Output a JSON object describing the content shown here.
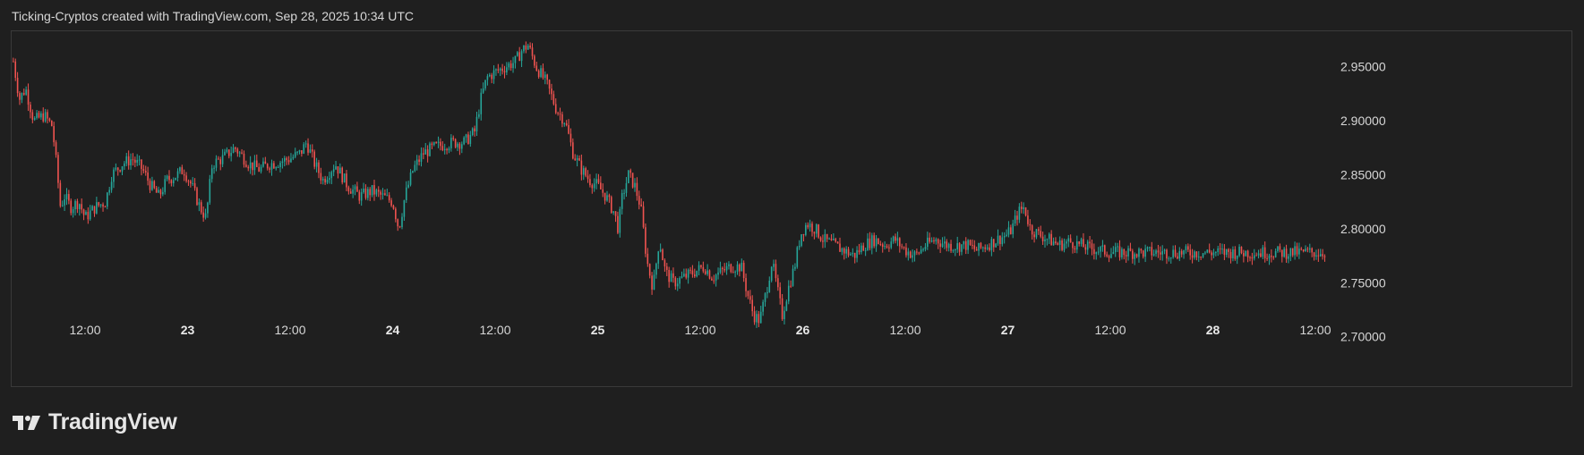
{
  "header": {
    "text": "Ticking-Cryptos created with TradingView.com, Sep 28, 2025 10:34 UTC"
  },
  "brand": {
    "name": "TradingView",
    "logo_icon": "tradingview-logo-icon"
  },
  "colors": {
    "background": "#1f1f1f",
    "up": "#26a69a",
    "down": "#ef5350",
    "text": "#d6d6d6",
    "border": "#3a3a3a"
  },
  "chart_data": {
    "type": "candlestick",
    "title": "",
    "xlabel": "",
    "ylabel": "",
    "ylim": [
      2.68,
      3.0
    ],
    "y_ticks": [
      "2.95000",
      "2.90000",
      "2.85000",
      "2.80000",
      "2.75000",
      "2.70000"
    ],
    "x_ticks": [
      {
        "label": "12:00",
        "t": 0.5,
        "bold": false
      },
      {
        "label": "23",
        "t": 1.0,
        "bold": true
      },
      {
        "label": "12:00",
        "t": 1.5,
        "bold": false
      },
      {
        "label": "24",
        "t": 2.0,
        "bold": true
      },
      {
        "label": "12:00",
        "t": 2.5,
        "bold": false
      },
      {
        "label": "25",
        "t": 3.0,
        "bold": true
      },
      {
        "label": "12:00",
        "t": 3.5,
        "bold": false
      },
      {
        "label": "26",
        "t": 4.0,
        "bold": true
      },
      {
        "label": "12:00",
        "t": 4.5,
        "bold": false
      },
      {
        "label": "27",
        "t": 5.0,
        "bold": true
      },
      {
        "label": "12:00",
        "t": 5.5,
        "bold": false
      },
      {
        "label": "28",
        "t": 6.0,
        "bold": true
      },
      {
        "label": "12:00",
        "t": 6.5,
        "bold": false
      }
    ],
    "x_range": [
      0.15,
      6.55
    ],
    "grid": false,
    "price_path": [
      [
        0.15,
        2.955
      ],
      [
        0.18,
        2.92
      ],
      [
        0.21,
        2.93
      ],
      [
        0.25,
        2.9
      ],
      [
        0.3,
        2.905
      ],
      [
        0.34,
        2.895
      ],
      [
        0.36,
        2.86
      ],
      [
        0.38,
        2.82
      ],
      [
        0.4,
        2.83
      ],
      [
        0.43,
        2.82
      ],
      [
        0.47,
        2.825
      ],
      [
        0.5,
        2.81
      ],
      [
        0.55,
        2.82
      ],
      [
        0.6,
        2.825
      ],
      [
        0.63,
        2.85
      ],
      [
        0.68,
        2.86
      ],
      [
        0.73,
        2.865
      ],
      [
        0.78,
        2.855
      ],
      [
        0.82,
        2.84
      ],
      [
        0.86,
        2.83
      ],
      [
        0.9,
        2.845
      ],
      [
        0.95,
        2.85
      ],
      [
        0.98,
        2.855
      ],
      [
        1.02,
        2.84
      ],
      [
        1.06,
        2.82
      ],
      [
        1.09,
        2.81
      ],
      [
        1.12,
        2.86
      ],
      [
        1.17,
        2.865
      ],
      [
        1.23,
        2.875
      ],
      [
        1.3,
        2.86
      ],
      [
        1.35,
        2.855
      ],
      [
        1.4,
        2.86
      ],
      [
        1.45,
        2.862
      ],
      [
        1.5,
        2.865
      ],
      [
        1.55,
        2.87
      ],
      [
        1.58,
        2.88
      ],
      [
        1.62,
        2.86
      ],
      [
        1.66,
        2.845
      ],
      [
        1.72,
        2.86
      ],
      [
        1.78,
        2.84
      ],
      [
        1.84,
        2.83
      ],
      [
        1.9,
        2.835
      ],
      [
        1.95,
        2.83
      ],
      [
        2.0,
        2.825
      ],
      [
        2.03,
        2.8
      ],
      [
        2.06,
        2.83
      ],
      [
        2.1,
        2.855
      ],
      [
        2.15,
        2.87
      ],
      [
        2.2,
        2.875
      ],
      [
        2.25,
        2.878
      ],
      [
        2.3,
        2.88
      ],
      [
        2.35,
        2.88
      ],
      [
        2.4,
        2.89
      ],
      [
        2.43,
        2.92
      ],
      [
        2.46,
        2.94
      ],
      [
        2.5,
        2.945
      ],
      [
        2.55,
        2.95
      ],
      [
        2.6,
        2.955
      ],
      [
        2.63,
        2.965
      ],
      [
        2.66,
        2.97
      ],
      [
        2.7,
        2.95
      ],
      [
        2.75,
        2.935
      ],
      [
        2.8,
        2.91
      ],
      [
        2.84,
        2.9
      ],
      [
        2.88,
        2.87
      ],
      [
        2.92,
        2.855
      ],
      [
        2.96,
        2.845
      ],
      [
        3.0,
        2.84
      ],
      [
        3.04,
        2.83
      ],
      [
        3.08,
        2.815
      ],
      [
        3.1,
        2.8
      ],
      [
        3.12,
        2.83
      ],
      [
        3.15,
        2.85
      ],
      [
        3.18,
        2.84
      ],
      [
        3.21,
        2.82
      ],
      [
        3.24,
        2.77
      ],
      [
        3.27,
        2.745
      ],
      [
        3.3,
        2.79
      ],
      [
        3.33,
        2.76
      ],
      [
        3.37,
        2.75
      ],
      [
        3.42,
        2.755
      ],
      [
        3.47,
        2.76
      ],
      [
        3.52,
        2.765
      ],
      [
        3.56,
        2.755
      ],
      [
        3.6,
        2.76
      ],
      [
        3.65,
        2.765
      ],
      [
        3.7,
        2.765
      ],
      [
        3.73,
        2.74
      ],
      [
        3.76,
        2.72
      ],
      [
        3.79,
        2.715
      ],
      [
        3.82,
        2.74
      ],
      [
        3.85,
        2.77
      ],
      [
        3.87,
        2.75
      ],
      [
        3.9,
        2.72
      ],
      [
        3.93,
        2.745
      ],
      [
        3.96,
        2.765
      ],
      [
        3.99,
        2.795
      ],
      [
        4.02,
        2.805
      ],
      [
        4.06,
        2.8
      ],
      [
        4.1,
        2.79
      ],
      [
        4.15,
        2.785
      ],
      [
        4.2,
        2.78
      ],
      [
        4.25,
        2.775
      ],
      [
        4.3,
        2.785
      ],
      [
        4.35,
        2.79
      ],
      [
        4.4,
        2.785
      ],
      [
        4.45,
        2.79
      ],
      [
        4.5,
        2.78
      ],
      [
        4.55,
        2.775
      ],
      [
        4.6,
        2.785
      ],
      [
        4.65,
        2.79
      ],
      [
        4.7,
        2.785
      ],
      [
        4.75,
        2.784
      ],
      [
        4.8,
        2.785
      ],
      [
        4.85,
        2.78
      ],
      [
        4.9,
        2.785
      ],
      [
        4.95,
        2.79
      ],
      [
        5.0,
        2.795
      ],
      [
        5.02,
        2.8
      ],
      [
        5.05,
        2.815
      ],
      [
        5.08,
        2.82
      ],
      [
        5.11,
        2.8
      ],
      [
        5.15,
        2.795
      ],
      [
        5.2,
        2.79
      ],
      [
        5.25,
        2.785
      ],
      [
        5.3,
        2.788
      ],
      [
        5.35,
        2.785
      ],
      [
        5.4,
        2.782
      ],
      [
        5.45,
        2.78
      ],
      [
        5.5,
        2.778
      ]
    ]
  }
}
